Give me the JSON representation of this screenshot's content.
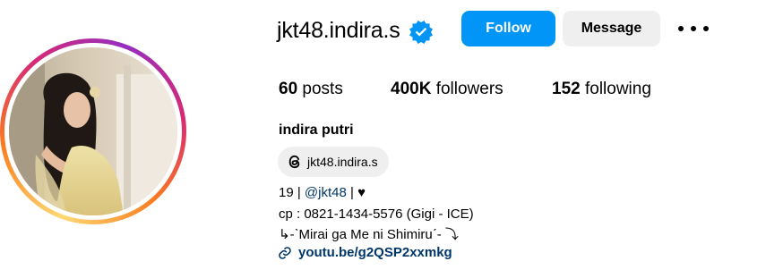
{
  "profile": {
    "username": "jkt48.indira.s",
    "verified": true,
    "full_name": "indira putri",
    "avatar_alt": "profile picture"
  },
  "actions": {
    "follow_label": "Follow",
    "message_label": "Message",
    "more_icon": "more-options-icon"
  },
  "stats": {
    "posts_count": "60",
    "posts_label": "posts",
    "followers_count": "400K",
    "followers_label": "followers",
    "following_count": "152",
    "following_label": "following"
  },
  "threads": {
    "icon": "threads-icon",
    "handle": "jkt48.indira.s"
  },
  "bio": {
    "line1_prefix": "19 | ",
    "line1_mention": "@jkt48",
    "line1_suffix": " | ♥",
    "line2": "cp : 0821-1434-5576 (Gigi - ICE)",
    "line3": "↳-ˋMirai ga Me ni Shimiruˊ- ⤵"
  },
  "link": {
    "icon": "link-icon",
    "text": "youtu.be/g2QSP2xxmkg"
  },
  "colors": {
    "follow_bg": "#0095f6",
    "secondary_bg": "#efefef",
    "link_text": "#00376b",
    "verified_badge": "#0095f6"
  }
}
